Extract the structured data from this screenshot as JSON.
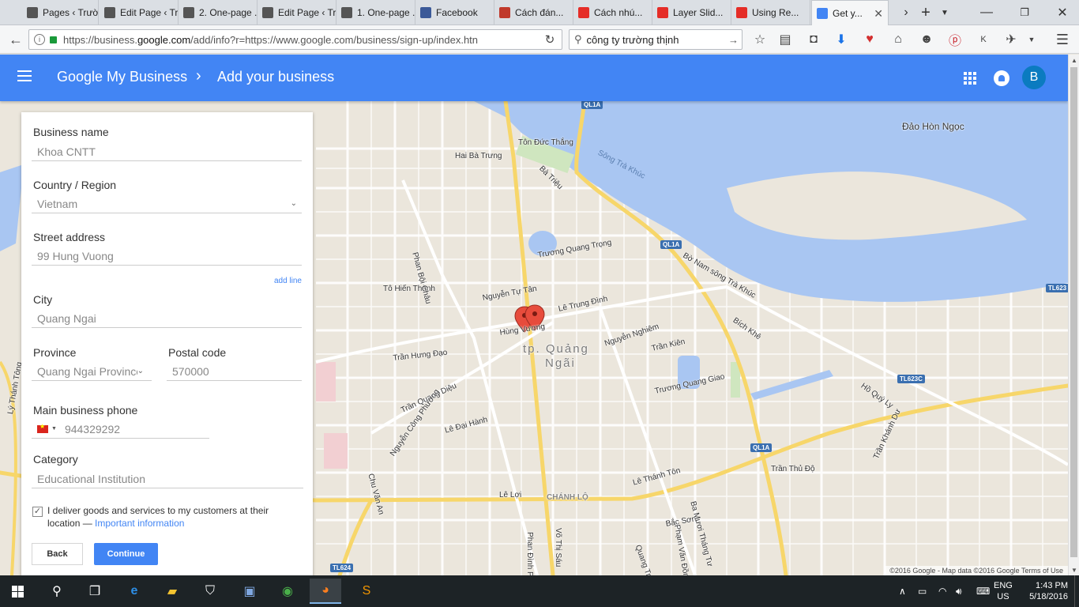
{
  "browser": {
    "tabs": [
      {
        "label": "Pages ‹ Trườn...",
        "icon": "wordpress-icon",
        "color": "#555555"
      },
      {
        "label": "Edit Page ‹ Tr...",
        "icon": "wordpress-icon",
        "color": "#555555"
      },
      {
        "label": "2. One-page ...",
        "icon": "page-icon",
        "color": "#555555"
      },
      {
        "label": "Edit Page ‹ Tr...",
        "icon": "wordpress-icon",
        "color": "#555555"
      },
      {
        "label": "1. One-page ...",
        "icon": "page-icon",
        "color": "#555555"
      },
      {
        "label": "Facebook",
        "icon": "facebook-icon",
        "color": "#3b5998"
      },
      {
        "label": "Cách đán...",
        "icon": "triangle-icon",
        "color": "#c0392b"
      },
      {
        "label": "Cách nhú...",
        "icon": "youtube-icon",
        "color": "#e52d27"
      },
      {
        "label": "Layer Slid...",
        "icon": "youtube-icon",
        "color": "#e52d27"
      },
      {
        "label": "Using Re...",
        "icon": "youtube-icon",
        "color": "#e52d27"
      },
      {
        "label": "Get y...",
        "icon": "gmb-icon",
        "color": "#4285f4"
      }
    ],
    "url_prefix": "https://business.",
    "url_host": "google.com",
    "url_suffix": "/add/info?r=https://www.google.com/business/sign-up/index.htn",
    "search_value": "công ty trường thịnh"
  },
  "header": {
    "title": "Google My Business",
    "separator": "›",
    "subtitle": "Add your business",
    "avatar_letter": "B"
  },
  "form": {
    "business_name_label": "Business name",
    "business_name_value": "Khoa CNTT",
    "country_label": "Country / Region",
    "country_value": "Vietnam",
    "street_label": "Street address",
    "street_value": "99 Hung Vuong",
    "add_line": "add line",
    "city_label": "City",
    "city_value": "Quang Ngai",
    "province_label": "Province",
    "province_value": "Quang Ngai Province",
    "postal_label": "Postal code",
    "postal_value": "570000",
    "phone_label": "Main business phone",
    "phone_value": "944329292",
    "category_label": "Category",
    "category_value": "Educational Institution",
    "deliver_text": "I deliver goods and services to my customers at their location —",
    "important_link": "Important information",
    "back_label": "Back",
    "continue_label": "Continue"
  },
  "map": {
    "labels": [
      {
        "text": "Đảo Hòn Ngọc",
        "kind": "place"
      },
      {
        "text": "Sông Trà Khúc",
        "kind": "water"
      },
      {
        "text": "Tôn Đức Thắng",
        "kind": "street"
      },
      {
        "text": "Hai Bà Trưng",
        "kind": "street"
      },
      {
        "text": "Bà Triệu",
        "kind": "street"
      },
      {
        "text": "Trương Quang Trọng",
        "kind": "street"
      },
      {
        "text": "Tô Hiến Thành",
        "kind": "street"
      },
      {
        "text": "Nguyễn Tự Tân",
        "kind": "street"
      },
      {
        "text": "Lê Trung Đình",
        "kind": "street"
      },
      {
        "text": "Hùng Vương",
        "kind": "street"
      },
      {
        "text": "Trần Hưng Đạo",
        "kind": "street"
      },
      {
        "text": "Nguyễn Nghiêm",
        "kind": "street"
      },
      {
        "text": "Trần Kiên",
        "kind": "street"
      },
      {
        "text": "Trương Quang Giao",
        "kind": "street"
      },
      {
        "text": "Bờ Nam sông Trà Khúc",
        "kind": "street"
      },
      {
        "text": "Bích Khê",
        "kind": "street"
      },
      {
        "text": "Hồ Quý Ly",
        "kind": "street"
      },
      {
        "text": "Trần Quang Diệu",
        "kind": "street"
      },
      {
        "text": "Lê Đại Hành",
        "kind": "street"
      },
      {
        "text": "Lê Lợi",
        "kind": "street"
      },
      {
        "text": "CHÁNH LỘ",
        "kind": "district"
      },
      {
        "text": "Lê Thánh Tôn",
        "kind": "street"
      },
      {
        "text": "Phan Đình Phùng",
        "kind": "street"
      },
      {
        "text": "Võ Thị Sáu",
        "kind": "street"
      },
      {
        "text": "Quang Trung",
        "kind": "street"
      },
      {
        "text": "Bắc Sơn",
        "kind": "street"
      },
      {
        "text": "Trần Thủ Độ",
        "kind": "street"
      },
      {
        "text": "Trần Khánh Dư",
        "kind": "street"
      },
      {
        "text": "Lý Thánh Tông",
        "kind": "street"
      },
      {
        "text": "Chu Văn An",
        "kind": "street"
      },
      {
        "text": "Nguyễn Công Phương",
        "kind": "street"
      },
      {
        "text": "Phan Bội Châu",
        "kind": "street"
      },
      {
        "text": "Ba Mươi Tháng Tư",
        "kind": "street"
      },
      {
        "text": "Phạm Văn Đồng",
        "kind": "street"
      }
    ],
    "city_name_line1": "tp. Quảng",
    "city_name_line2": "Ngãi",
    "badges": [
      "QL1A",
      "QL1A",
      "QL1A",
      "TL623",
      "TL623C",
      "TL624"
    ],
    "attribution": "©2016 Google - Map data ©2016 Google   Terms of Use"
  },
  "taskbar": {
    "lang1": "ENG",
    "lang2": "US",
    "time": "1:43 PM",
    "date": "5/18/2016"
  },
  "colors": {
    "gmb_blue": "#4285f4",
    "water": "#a9c6f2",
    "major_road": "#f7d66a"
  }
}
